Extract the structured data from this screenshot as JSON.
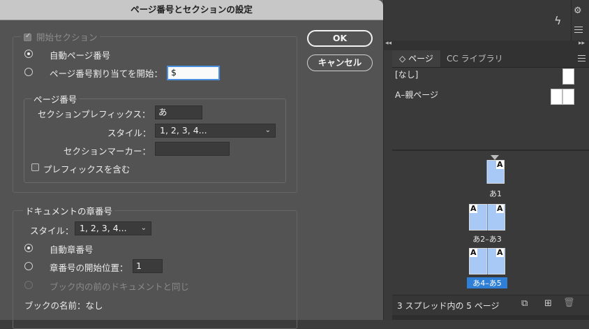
{
  "dialog": {
    "title": "ページ番号とセクションの設定",
    "ok_label": "OK",
    "cancel_label": "キャンセル",
    "start_section": {
      "label": "開始セクション",
      "checked": true,
      "auto_numbering_label": "自動ページ番号",
      "start_at_label": "ページ番号割り当てを開始：",
      "start_at_value": "$",
      "page_numbering": {
        "legend": "ページ番号",
        "section_prefix_label": "セクションプレフィックス：",
        "section_prefix_value": "あ",
        "style_label": "スタイル：",
        "style_value": "1, 2, 3, 4...",
        "section_marker_label": "セクションマーカー：",
        "section_marker_value": "",
        "include_prefix_label": "プレフィックスを含む"
      }
    },
    "chapter_numbering": {
      "legend": "ドキュメントの章番号",
      "style_label": "スタイル：",
      "style_value": "1, 2, 3, 4...",
      "auto_chapter_label": "自動章番号",
      "start_chapter_label": "章番号の開始位置：",
      "start_chapter_value": "1",
      "same_as_previous_label": "ブック内の前のドキュメントと同じ",
      "book_name_label": "ブックの名前：なし"
    }
  },
  "pages_panel": {
    "tabs": [
      {
        "label": "ページ",
        "prefix": "◇"
      },
      {
        "label": "CC ライブラリ"
      }
    ],
    "masters": [
      {
        "label": "[なし]"
      },
      {
        "label": "A–親ページ"
      }
    ],
    "page_marker": "A",
    "spreads": [
      {
        "label": "あ1",
        "selected": false
      },
      {
        "label": "あ2–あ3",
        "selected": false
      },
      {
        "label": "あ4–あ5",
        "selected": true
      }
    ],
    "footer_text": "3 スプレッド内の 5 ページ"
  },
  "colors": {
    "dialog_bg": "#535353",
    "titlebar_bg": "#c7c7c7",
    "page_thumb": "#a8c9f5",
    "selection": "#2f7fd6"
  }
}
